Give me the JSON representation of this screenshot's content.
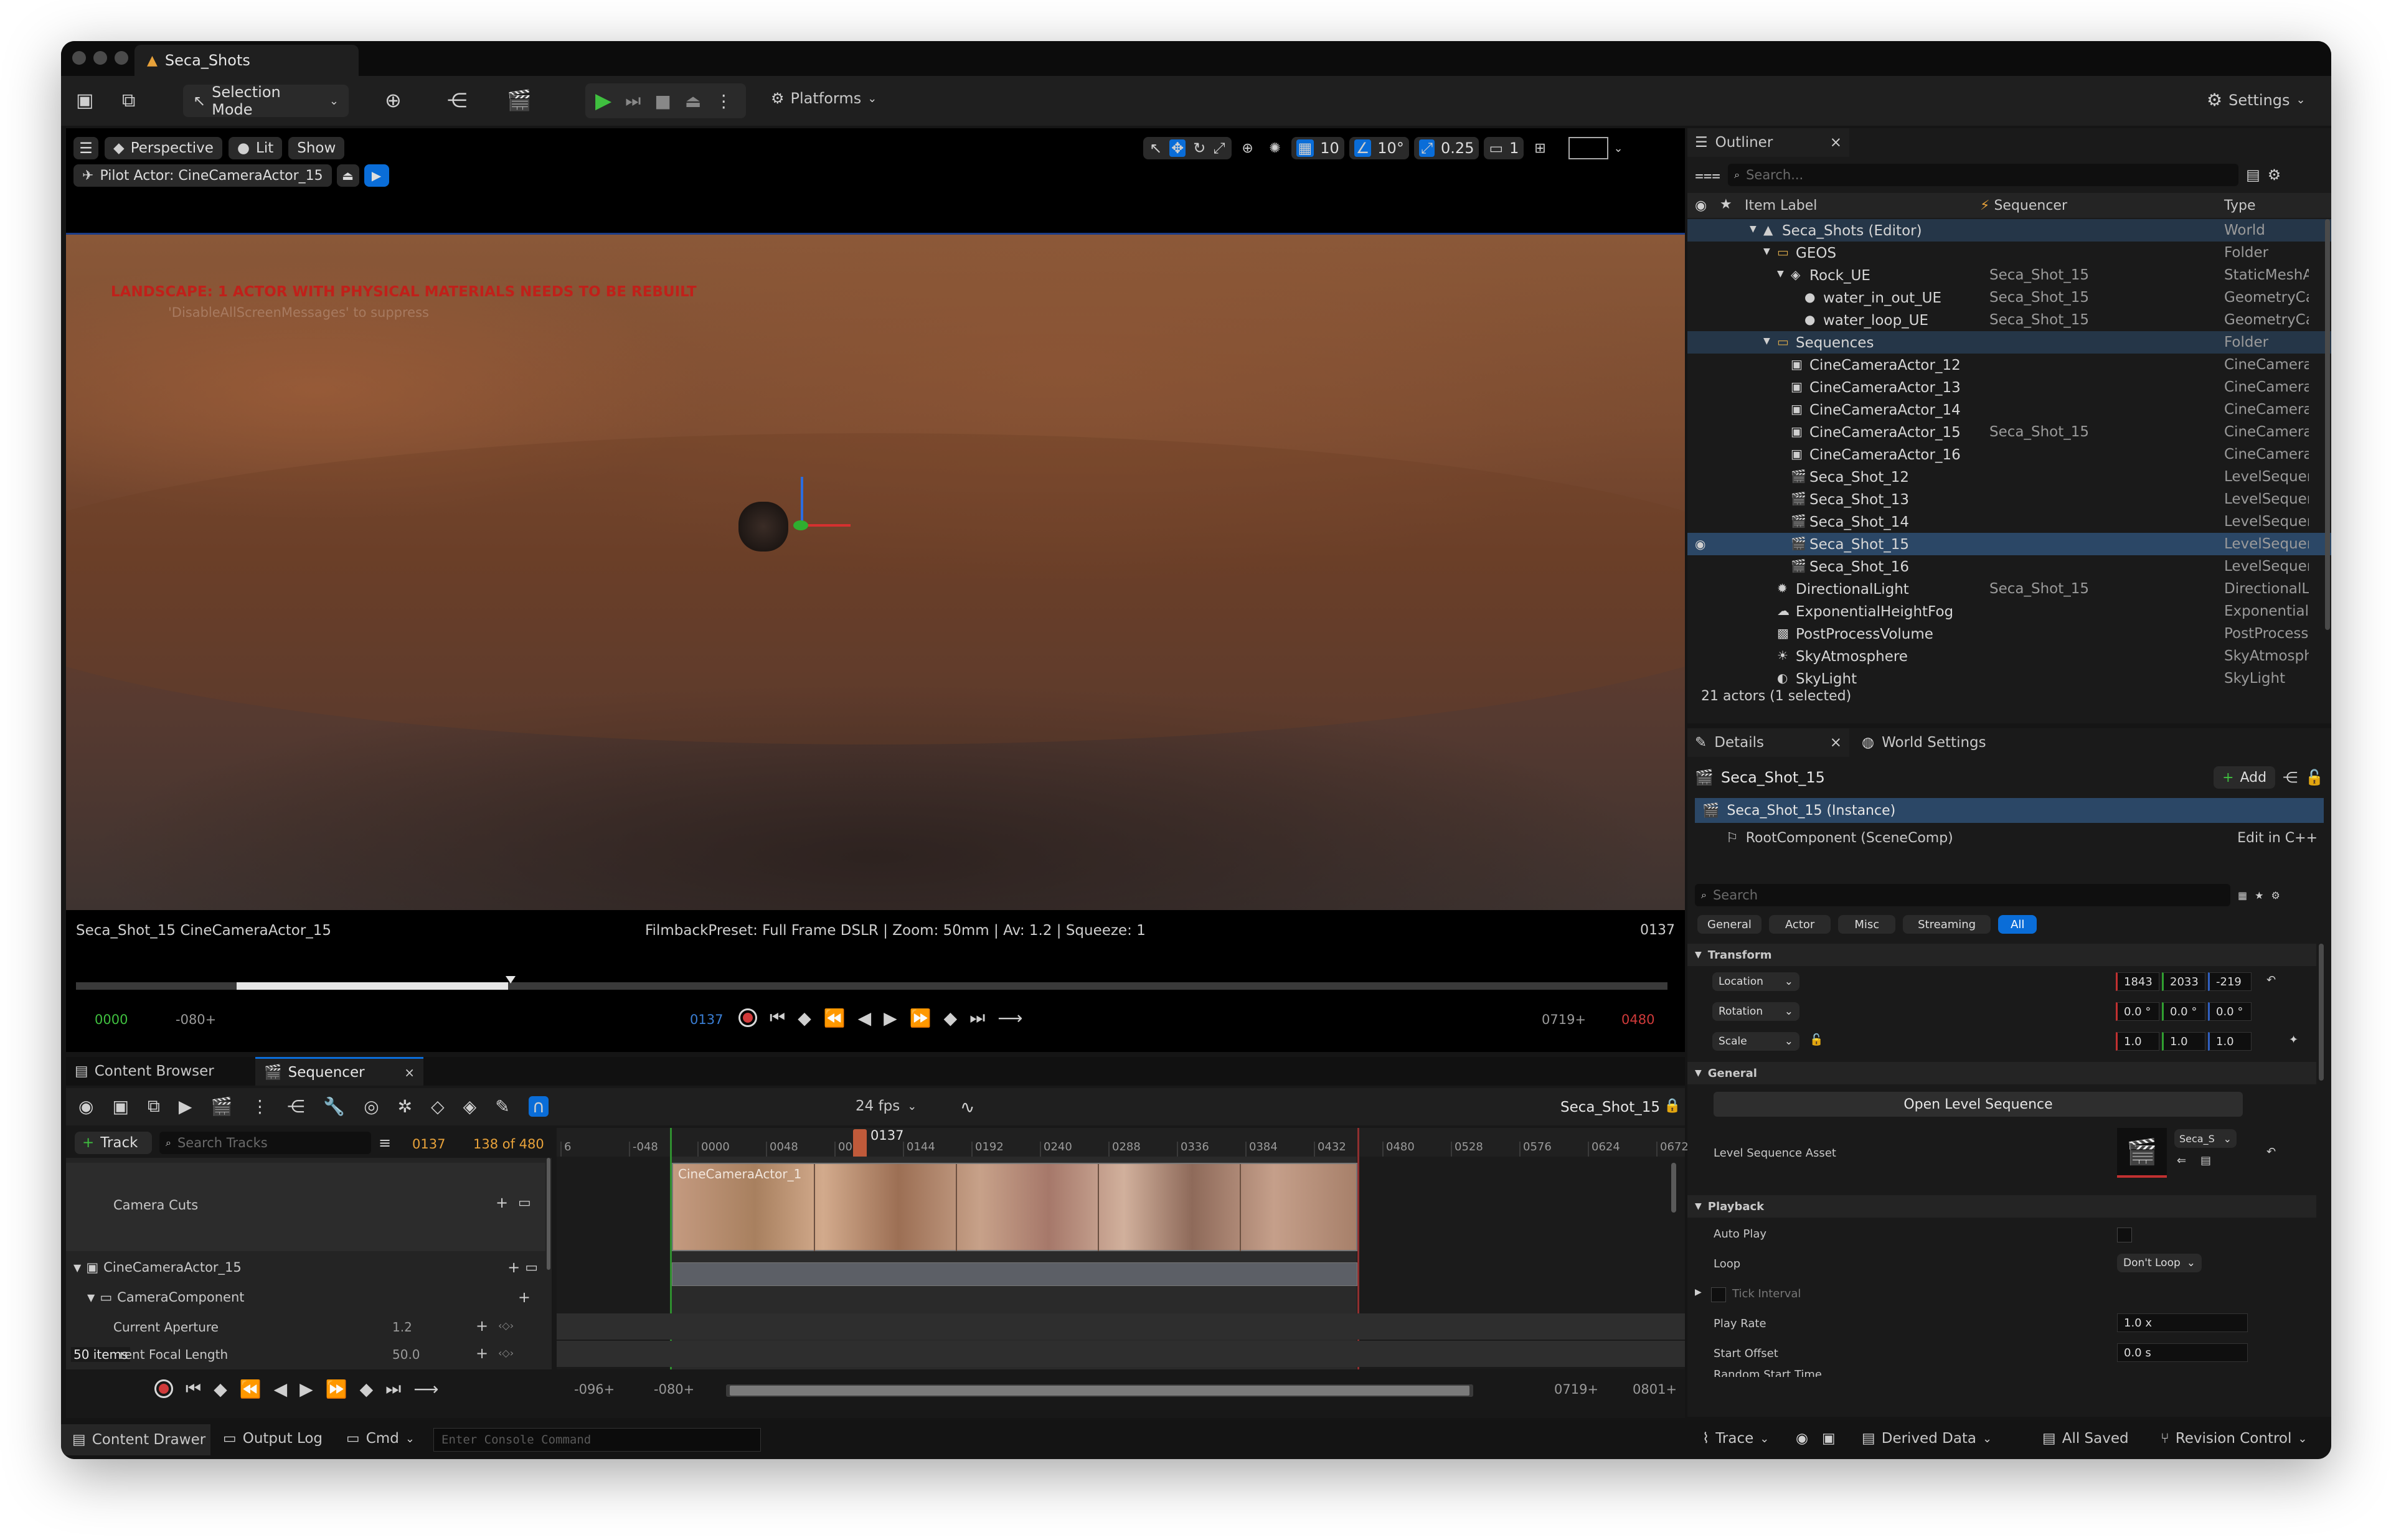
{
  "window": {
    "title": "Seca_Shots"
  },
  "toolbar": {
    "selection_mode": "Selection Mode",
    "platforms": "Platforms",
    "settings": "Settings"
  },
  "viewport": {
    "perspective": "Perspective",
    "lit": "Lit",
    "show": "Show",
    "grid_value": "10",
    "angle_value": "10°",
    "scale_value": "0.25",
    "camera_speed": "1",
    "pilot_label": "Pilot Actor: CineCameraActor_15",
    "warning_line1": "LANDSCAPE: 1 ACTOR WITH PHYSICAL MATERIALS NEEDS TO BE REBUILT",
    "warning_line2": "'DisableAllScreenMessages' to suppress",
    "shot_info": "Seca_Shot_15 CineCameraActor_15",
    "filmback": "FilmbackPreset: Full Frame DSLR | Zoom: 50mm | Av: 1.2 | Squeeze: 1",
    "frame": "0137",
    "transport": {
      "start": "0000",
      "pre": "-080+",
      "current": "0137",
      "post": "0719+",
      "end": "0480"
    }
  },
  "outliner": {
    "tab": "Outliner",
    "search_placeholder": "Search...",
    "col_label": "Item Label",
    "col_sequencer": "Sequencer",
    "col_type": "Type",
    "rows": [
      {
        "label": "Seca_Shots (Editor)",
        "seq": "",
        "type": "World"
      },
      {
        "label": "GEOS",
        "seq": "",
        "type": "Folder"
      },
      {
        "label": "Rock_UE",
        "seq": "Seca_Shot_15",
        "type": "StaticMeshA"
      },
      {
        "label": "water_in_out_UE",
        "seq": "Seca_Shot_15",
        "type": "GeometryCa"
      },
      {
        "label": "water_loop_UE",
        "seq": "Seca_Shot_15",
        "type": "GeometryCa"
      },
      {
        "label": "Sequences",
        "seq": "",
        "type": "Folder"
      },
      {
        "label": "CineCameraActor_12",
        "seq": "",
        "type": "CineCamera"
      },
      {
        "label": "CineCameraActor_13",
        "seq": "",
        "type": "CineCamera"
      },
      {
        "label": "CineCameraActor_14",
        "seq": "",
        "type": "CineCamera"
      },
      {
        "label": "CineCameraActor_15",
        "seq": "Seca_Shot_15",
        "type": "CineCamera"
      },
      {
        "label": "CineCameraActor_16",
        "seq": "",
        "type": "CineCamera"
      },
      {
        "label": "Seca_Shot_12",
        "seq": "",
        "type": "LevelSequer"
      },
      {
        "label": "Seca_Shot_13",
        "seq": "",
        "type": "LevelSequer"
      },
      {
        "label": "Seca_Shot_14",
        "seq": "",
        "type": "LevelSequer"
      },
      {
        "label": "Seca_Shot_15",
        "seq": "",
        "type": "LevelSequer"
      },
      {
        "label": "Seca_Shot_16",
        "seq": "",
        "type": "LevelSequer"
      },
      {
        "label": "DirectionalLight",
        "seq": "Seca_Shot_15",
        "type": "DirectionalLi"
      },
      {
        "label": "ExponentialHeightFog",
        "seq": "",
        "type": "ExponentialH"
      },
      {
        "label": "PostProcessVolume",
        "seq": "",
        "type": "PostProcess"
      },
      {
        "label": "SkyAtmosphere",
        "seq": "",
        "type": "SkyAtmosph"
      },
      {
        "label": "SkyLight",
        "seq": "",
        "type": "SkyLight"
      }
    ],
    "status": "21 actors (1 selected)"
  },
  "details": {
    "tab": "Details",
    "world_settings": "World Settings",
    "object_name": "Seca_Shot_15",
    "add": "Add",
    "instance": "Seca_Shot_15 (Instance)",
    "root": "RootComponent (SceneComp)",
    "edit_cpp": "Edit in C++",
    "search_placeholder": "Search",
    "filters": [
      "General",
      "Actor",
      "Misc",
      "Streaming",
      "All"
    ],
    "transform_header": "Transform",
    "location": "Location",
    "rotation": "Rotation",
    "scale": "Scale",
    "loc": [
      "1843",
      "2033",
      "-219"
    ],
    "rot": [
      "0.0 °",
      "0.0 °",
      "0.0 °"
    ],
    "scl": [
      "1.0",
      "1.0",
      "1.0"
    ],
    "general_header": "General",
    "open_seq": "Open Level Sequence",
    "level_seq_asset": "Level Sequence Asset",
    "asset_name": "Seca_S",
    "playback_header": "Playback",
    "auto_play": "Auto Play",
    "loop": "Loop",
    "loop_value": "Don't Loop",
    "tick_interval": "Tick Interval",
    "play_rate": "Play Rate",
    "play_rate_value": "1.0 x",
    "start_offset": "Start Offset",
    "start_offset_value": "0.0 s",
    "random_start": "Random Start Time"
  },
  "sequencer": {
    "tabs": [
      "Content Browser",
      "Sequencer"
    ],
    "fps": "24 fps",
    "sequence_name": "Seca_Shot_15",
    "track_button": "Track",
    "search_placeholder": "Search Tracks",
    "frame": "0137",
    "count": "138 of 480",
    "playhead_label": "0137",
    "ruler": [
      "6",
      "-048",
      "0000",
      "0048",
      "0096",
      "0144",
      "0192",
      "0240",
      "0288",
      "0336",
      "0384",
      "0432",
      "0480",
      "0528",
      "0576",
      "0624",
      "0672"
    ],
    "tracks": {
      "camera_cuts": "Camera Cuts",
      "camera_actor": "CineCameraActor_15",
      "camera_component": "CameraComponent",
      "aperture": "Current Aperture",
      "aperture_value": "1.2",
      "focal": "rent Focal Length",
      "focal_value": "50.0"
    },
    "clip_label": "CineCameraActor_1",
    "items": "50 items",
    "bottom": {
      "a": "-096+",
      "b": "-080+",
      "c": "0719+",
      "d": "0801+"
    }
  },
  "statusbar": {
    "content_drawer": "Content Drawer",
    "output_log": "Output Log",
    "cmd": "Cmd",
    "console_placeholder": "Enter Console Command",
    "trace": "Trace",
    "derived_data": "Derived Data",
    "all_saved": "All Saved",
    "revision_control": "Revision Control"
  },
  "colors": {
    "accent": "#0a6dd8",
    "selected_row": "#2b4766",
    "play_green": "#3fbf3f",
    "record_red": "#d03a3a",
    "warning": "#c0201a"
  }
}
